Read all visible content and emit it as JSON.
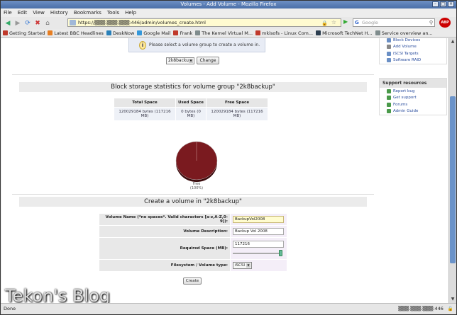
{
  "window": {
    "title": "Volumes - Add Volume - Mozilla Firefox"
  },
  "menu": [
    "File",
    "Edit",
    "View",
    "History",
    "Bookmarks",
    "Tools",
    "Help"
  ],
  "urlbar": {
    "value": "https://▒▒▒.▒▒▒.▒▒▒:446/admin/volumes_create.html"
  },
  "search": {
    "placeholder": "Google"
  },
  "bookmarks": [
    {
      "label": "Getting Started",
      "color": "#c0392b"
    },
    {
      "label": "Latest BBC Headlines",
      "color": "#e67e22"
    },
    {
      "label": "DeskNow",
      "color": "#2980b9"
    },
    {
      "label": "Google Mail",
      "color": "#3498db"
    },
    {
      "label": "Frank",
      "color": "#c0392b"
    },
    {
      "label": "The Kernel Virtual M...",
      "color": "#7f8c8d"
    },
    {
      "label": "mkisofs - Linux Com...",
      "color": "#c0392b"
    },
    {
      "label": "Microsoft TechNet H...",
      "color": "#2c3e50"
    },
    {
      "label": "Service overview an...",
      "color": "#7f8c8d"
    }
  ],
  "alert": {
    "text": "Please select a volume group to create a volume in."
  },
  "vg_select": {
    "value": "2k8backup"
  },
  "change_label": "Change",
  "stats": {
    "title": "Block storage statistics for volume group \"2k8backup\"",
    "headers": [
      "Total Space",
      "Used Space",
      "Free Space"
    ],
    "values": [
      "120029184 bytes (117216 MB)",
      "0 bytes (0 MB)",
      "120029184 bytes (117216 MB)"
    ]
  },
  "pie": {
    "label_line1": "Free",
    "label_line2": "(100%)",
    "free_percent": 100,
    "color": "#7a1a1f"
  },
  "create": {
    "title": "Create a volume in \"2k8backup\"",
    "name_label": "Volume Name (*no spaces*. Valid characters [a-z,A-Z,0-9]):",
    "name_value": "BackupVol2008",
    "desc_label": "Volume Description:",
    "desc_value": "Backup Vol 2008",
    "space_label": "Required Space (MB):",
    "space_value": "117216",
    "space_fraction": 1.0,
    "fs_label": "Filesystem / Volume type:",
    "fs_value": "iSCSI",
    "button_label": "Create"
  },
  "sidebar": {
    "volumes_items": [
      {
        "label": "Block Devices",
        "color": "#6a8fc5"
      },
      {
        "label": "Add Volume",
        "color": "#888888"
      },
      {
        "label": "iSCSI Targets",
        "color": "#6a8fc5"
      },
      {
        "label": "Software RAID",
        "color": "#6a8fc5"
      }
    ],
    "support_head": "Support resources",
    "support_items": [
      {
        "label": "Report bug",
        "color": "#4a9a4a"
      },
      {
        "label": "Get support",
        "color": "#4a9a4a"
      },
      {
        "label": "Forums",
        "color": "#4a9a4a"
      },
      {
        "label": "Admin Guide",
        "color": "#4a9a4a"
      }
    ]
  },
  "watermark": "Tekon's Blog",
  "status": {
    "left": "Done",
    "right": "▒▒▒.▒▒▒.▒▒▒:446"
  }
}
